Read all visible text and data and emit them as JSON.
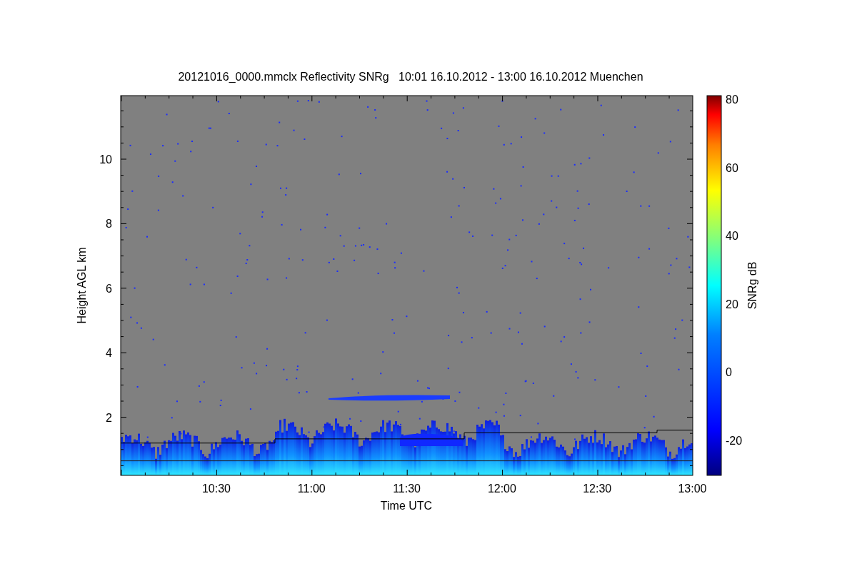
{
  "title": "20121016_0000.mmclx Reflectivity SNRg   10:01 16.10.2012 - 13:00 16.10.2012 Muenchen",
  "y_axis": {
    "label": "Height AGL km",
    "ticks": [
      "10",
      "8",
      "6",
      "4",
      "2"
    ]
  },
  "x_axis": {
    "label": "Time UTC",
    "ticks": [
      "10:30",
      "11:00",
      "11:30",
      "12:00",
      "12:30",
      "13:00"
    ]
  },
  "colorbar": {
    "label": "SNRg dB",
    "ticks": [
      "80",
      "60",
      "40",
      "20",
      "0",
      "-20"
    ]
  }
}
